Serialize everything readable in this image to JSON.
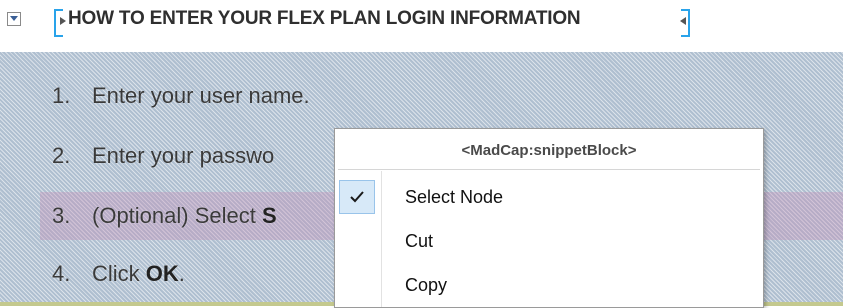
{
  "heading": {
    "title": "HOW TO ENTER YOUR FLEX PLAN LOGIN INFORMATION"
  },
  "steps": [
    {
      "number": "1.",
      "text": "Enter your user name."
    },
    {
      "number": "2.",
      "text": "Enter your passwo"
    },
    {
      "number": "3.",
      "text": "(Optional) Select ",
      "bold": "S"
    },
    {
      "number": "4.",
      "text": "Click ",
      "bold": "OK",
      "after": "."
    }
  ],
  "context_menu": {
    "title": "<MadCap:snippetBlock>",
    "items": [
      {
        "label": "Select Node",
        "checked": true
      },
      {
        "label": "Cut",
        "checked": false
      },
      {
        "label": "Copy",
        "checked": false
      }
    ]
  },
  "icons": {
    "collapse": "collapse-toggle-icon",
    "check": "checkmark-icon"
  },
  "colors": {
    "bracket": "#29a3ea",
    "selection": "#afbfd0",
    "highlight_row": "#c48ab4"
  }
}
